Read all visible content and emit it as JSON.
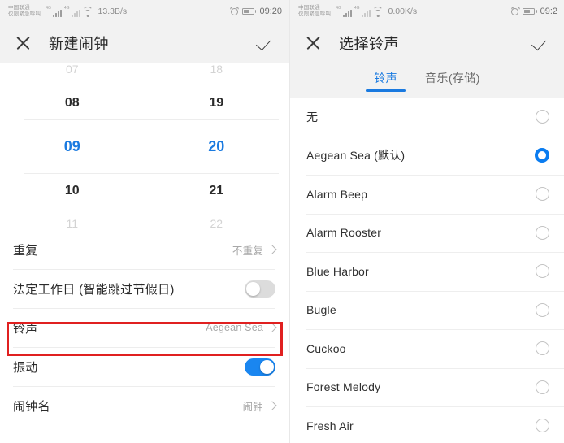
{
  "left": {
    "status": {
      "carrier_line1": "中国联通",
      "carrier_line2": "仅限紧急呼叫",
      "network_tag": "4G",
      "net_speed": "13.3B/s",
      "time": "09:20",
      "alarm_icon": "alarm-clock-icon",
      "battery_icon": "battery-icon",
      "wifi_icon": "wifi-icon"
    },
    "header": {
      "close_icon": "close-icon",
      "title": "新建闹钟",
      "confirm_icon": "check-icon"
    },
    "time_picker": {
      "hours": [
        "07",
        "08",
        "09",
        "10",
        "11"
      ],
      "minutes": [
        "18",
        "19",
        "20",
        "21",
        "22"
      ],
      "selected_hour": "09",
      "selected_minute": "20",
      "accent_color": "#1a7ae0"
    },
    "settings": [
      {
        "label": "重复",
        "value": "不重复",
        "type": "chevron"
      },
      {
        "label": "法定工作日 (智能跳过节假日)",
        "value": "",
        "type": "toggle",
        "on": false
      },
      {
        "label": "铃声",
        "value": "Aegean Sea",
        "type": "chevron",
        "highlighted": true
      },
      {
        "label": "振动",
        "value": "",
        "type": "toggle",
        "on": true
      },
      {
        "label": "闹钟名",
        "value": "闹钟",
        "type": "chevron"
      }
    ],
    "highlight_color": "#e02020"
  },
  "right": {
    "status": {
      "carrier_line1": "中国联通",
      "carrier_line2": "仅限紧急呼叫",
      "network_tag": "4G",
      "net_speed": "0.00K/s",
      "time": "09:2",
      "alarm_icon": "alarm-clock-icon",
      "battery_icon": "battery-icon",
      "wifi_icon": "wifi-icon"
    },
    "header": {
      "close_icon": "close-icon",
      "title": "选择铃声",
      "confirm_icon": "check-icon"
    },
    "tabs": [
      {
        "label": "铃声",
        "active": true
      },
      {
        "label": "音乐(存储)",
        "active": false
      }
    ],
    "ringtones": [
      {
        "label": "无",
        "selected": false
      },
      {
        "label": "Aegean Sea (默认)",
        "selected": true
      },
      {
        "label": "Alarm Beep",
        "selected": false
      },
      {
        "label": "Alarm Rooster",
        "selected": false
      },
      {
        "label": "Blue Harbor",
        "selected": false
      },
      {
        "label": "Bugle",
        "selected": false
      },
      {
        "label": "Cuckoo",
        "selected": false
      },
      {
        "label": "Forest Melody",
        "selected": false
      },
      {
        "label": "Fresh Air",
        "selected": false
      }
    ],
    "accent_color": "#0a7cf0"
  }
}
